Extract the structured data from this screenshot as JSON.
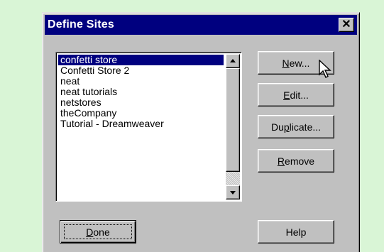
{
  "dialog": {
    "title": "Define Sites",
    "close_glyph": "✕"
  },
  "sites": [
    {
      "label": "confetti store",
      "selected": true
    },
    {
      "label": "Confetti Store 2",
      "selected": false
    },
    {
      "label": "neat",
      "selected": false
    },
    {
      "label": "neat tutorials",
      "selected": false
    },
    {
      "label": "netstores",
      "selected": false
    },
    {
      "label": "theCompany",
      "selected": false
    },
    {
      "label": "Tutorial - Dreamweaver",
      "selected": false
    }
  ],
  "buttons": {
    "new": {
      "mnemonic": "N",
      "rest": "ew..."
    },
    "edit": {
      "mnemonic": "E",
      "rest": "dit..."
    },
    "duplicate": {
      "pre": "Du",
      "mnemonic": "p",
      "rest": "licate..."
    },
    "remove": {
      "mnemonic": "R",
      "rest": "emove"
    },
    "done": {
      "mnemonic": "D",
      "rest": "one"
    },
    "help": {
      "label": "Help"
    }
  },
  "colors": {
    "page_background": "#d9f5d6",
    "dialog_face": "#c0c0c0",
    "titlebar": "#00007f",
    "selection": "#00007f"
  },
  "icons": {
    "close": "close-icon",
    "scroll_up": "scroll-up-arrow-icon",
    "scroll_down": "scroll-down-arrow-icon",
    "cursor": "mouse-pointer-icon"
  }
}
